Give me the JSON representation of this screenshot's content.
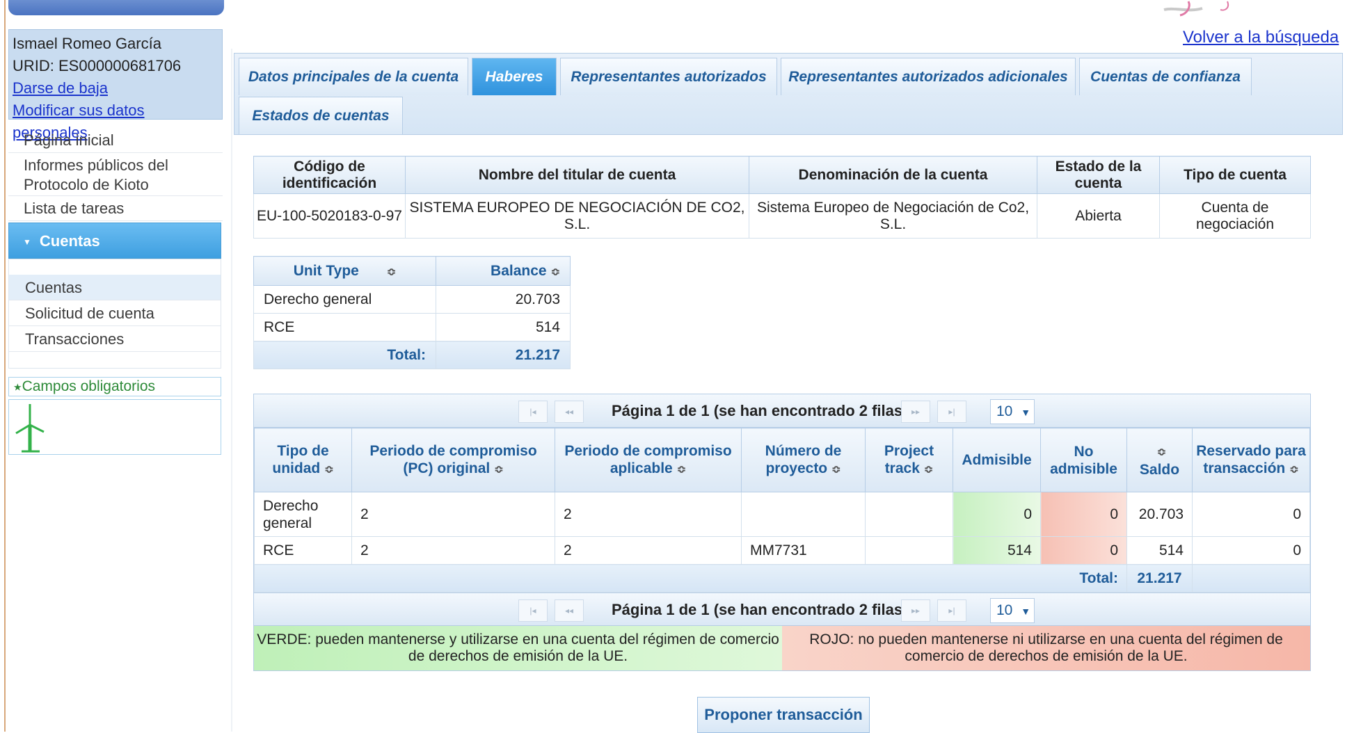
{
  "header": {
    "back_link": "Volver a la búsqueda"
  },
  "user": {
    "name": "Ismael Romeo García",
    "urid": "URID: ES000000681706",
    "unsubscribe": "Darse de baja",
    "edit_profile": "Modificar sus datos personales"
  },
  "nav": {
    "home": "Página inicial",
    "kyoto": "Informes públicos del Protocolo de Kioto",
    "tasks": "Lista de tareas",
    "section": "Cuentas",
    "sub": [
      "Cuentas",
      "Solicitud de cuenta",
      "Transacciones"
    ],
    "required": "Campos obligatorios"
  },
  "tabs": [
    "Datos principales de la cuenta",
    "Haberes",
    "Representantes autorizados",
    "Representantes autorizados adicionales",
    "Cuentas de confianza",
    "Estados de cuentas"
  ],
  "account": {
    "headers": [
      "Código de identificación",
      "Nombre del titular de cuenta",
      "Denominación de la cuenta",
      "Estado de la cuenta",
      "Tipo de cuenta"
    ],
    "row": [
      "EU-100-5020183-0-97",
      "SISTEMA EUROPEO DE NEGOCIACIÓN DE CO2, S.L.",
      "Sistema Europeo de Negociación de Co2, S.L.",
      "Abierta",
      "Cuenta de negociación"
    ]
  },
  "balance": {
    "headers": [
      "Unit Type",
      "Balance"
    ],
    "rows": [
      [
        "Derecho general",
        "20.703"
      ],
      [
        "RCE",
        "514"
      ]
    ],
    "total_label": "Total:",
    "total_value": "21.217"
  },
  "detail": {
    "pager_text": "Página 1 de 1 (se han encontrado 2 filas)",
    "page_size": "10",
    "headers": [
      "Tipo de unidad",
      "Periodo de compromiso (PC) original",
      "Periodo de compromiso aplicable",
      "Número de proyecto",
      "Project track",
      "Admisible",
      "No admisible",
      "Saldo",
      "Reservado para transacción"
    ],
    "rows": [
      [
        "Derecho general",
        "2",
        "2",
        "",
        "",
        "0",
        "0",
        "20.703",
        "0"
      ],
      [
        "RCE",
        "2",
        "2",
        "MM7731",
        "",
        "514",
        "0",
        "514",
        "0"
      ]
    ],
    "total_label": "Total:",
    "total_value": "21.217",
    "legend_green": "VERDE: pueden mantenerse y utilizarse en una cuenta del régimen de comercio de derechos de emisión de la UE.",
    "legend_red": "ROJO: no pueden mantenerse ni utilizarse en una cuenta del régimen de comercio de derechos de emisión de la UE."
  },
  "actions": {
    "propose": "Proponer transacción"
  },
  "colors": {
    "accent": "#2f92dd",
    "link": "#1a33cc",
    "green": "#c6f0c0",
    "red": "#f6c0b4"
  }
}
